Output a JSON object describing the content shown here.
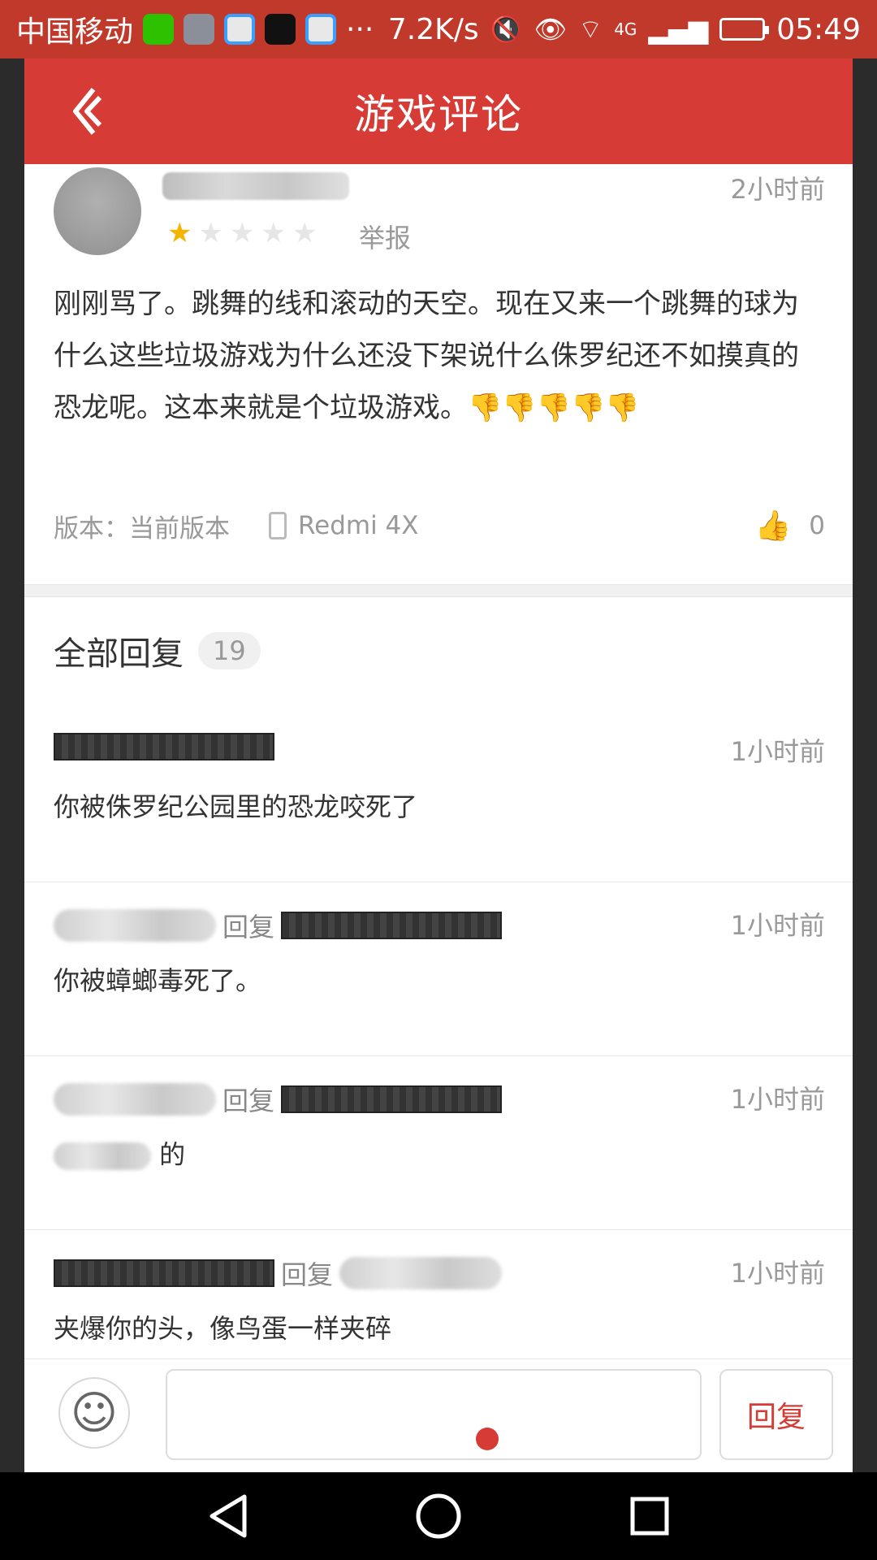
{
  "status_bar": {
    "carrier": "中国移动",
    "speed": "7.2K/s",
    "network": "4G",
    "time": "05:49",
    "icons": [
      "wechat-icon",
      "gallery-icon",
      "baidu-icon",
      "tiktok-icon",
      "more-icon",
      "mute-icon",
      "eye-icon",
      "wifi-icon",
      "signal-icon",
      "battery-icon"
    ],
    "more_label": "···"
  },
  "header": {
    "title": "游戏评论",
    "back_icon": "back-arrow-icon"
  },
  "review": {
    "time": "2小时前",
    "rating": 1,
    "rating_max": 5,
    "report_label": "举报",
    "text": "刚刚骂了。跳舞的线和滚动的天空。现在又来一个跳舞的球为什么这些垃圾游戏为什么还没下架说什么侏罗纪还不如摸真的恐龙呢。这本来就是个垃圾游戏。👎👎👎👎👎",
    "version": "版本：当前版本",
    "device": "Redmi 4X",
    "likes": "0"
  },
  "replies": {
    "title": "全部回复",
    "count": "19",
    "reply_word": "回复",
    "items": [
      {
        "time": "1小时前",
        "text": "你被侏罗纪公园里的恐龙咬死了"
      },
      {
        "time": "1小时前",
        "text": "你被蟑螂毒死了。"
      },
      {
        "time": "1小时前",
        "text": "的"
      },
      {
        "time": "1小时前",
        "text": "夹爆你的头，像鸟蛋一样夹碎"
      }
    ]
  },
  "input_bar": {
    "placeholder": "",
    "send_label": "回复",
    "emoji_icon": "smiley-icon"
  },
  "colors": {
    "accent": "#d63b35",
    "star_on": "#f5b400",
    "muted_text": "#999999"
  }
}
